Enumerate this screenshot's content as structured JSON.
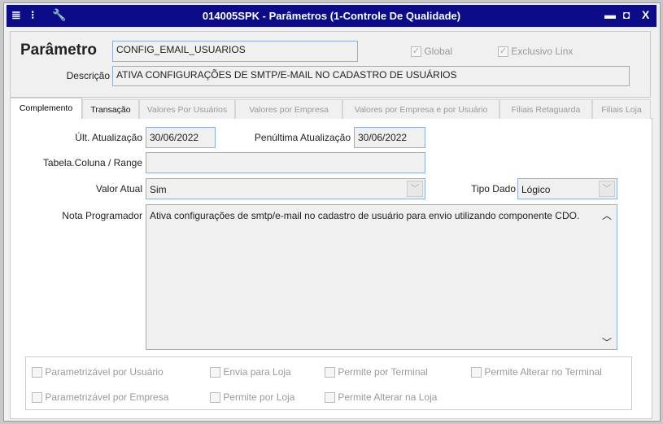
{
  "window": {
    "title": "014005SPK - Parâmetros (1-Controle De Qualidade)",
    "icons": [
      "menu-icon",
      "traffic-light-icon",
      "wrench-icon"
    ],
    "controls": {
      "minimize": "▬",
      "maximize": "◘",
      "close": "X"
    }
  },
  "header": {
    "parametro_label": "Parâmetro",
    "parametro_value": "CONFIG_EMAIL_USUARIOS",
    "global_label": "Global",
    "global_checked": true,
    "exclusivo_label": "Exclusivo Linx",
    "exclusivo_checked": true,
    "descricao_label": "Descrição",
    "descricao_value": "ATIVA CONFIGURAÇÕES DE SMTP/E-MAIL NO CADASTRO DE USUÁRIOS"
  },
  "tabs": [
    {
      "label": "Complemento",
      "active": true
    },
    {
      "label": "Transação"
    },
    {
      "label": "Valores Por Usuários"
    },
    {
      "label": "Valores por Empresa"
    },
    {
      "label": "Valores por Empresa e por Usuário"
    },
    {
      "label": "Filiais Retaguarda"
    },
    {
      "label": "Filiais Loja"
    }
  ],
  "form": {
    "ult_label": "Últ. Atualização",
    "ult_value": "30/06/2022",
    "penult_label": "Penúltima Atualização",
    "penult_value": "30/06/2022",
    "tabela_label": "Tabela.Coluna / Range",
    "tabela_value": "",
    "valor_label": "Valor Atual",
    "valor_value": "Sim",
    "tipo_label": "Tipo Dado",
    "tipo_value": "Lógico",
    "nota_label": "Nota Programador",
    "nota_value": "Ativa configurações de smtp/e-mail no cadastro de usuário para envio utilizando componente CDO."
  },
  "options": [
    "Parametrizável por Usuário",
    "Envia para Loja",
    "Permite por Terminal",
    "Permite Alterar no Terminal",
    "Parametrizável por Empresa",
    "Permite por Loja",
    "Permite Alterar na Loja"
  ],
  "colors": {
    "title_bar": "#0c0c88",
    "input_border": "#8fb0d0"
  }
}
